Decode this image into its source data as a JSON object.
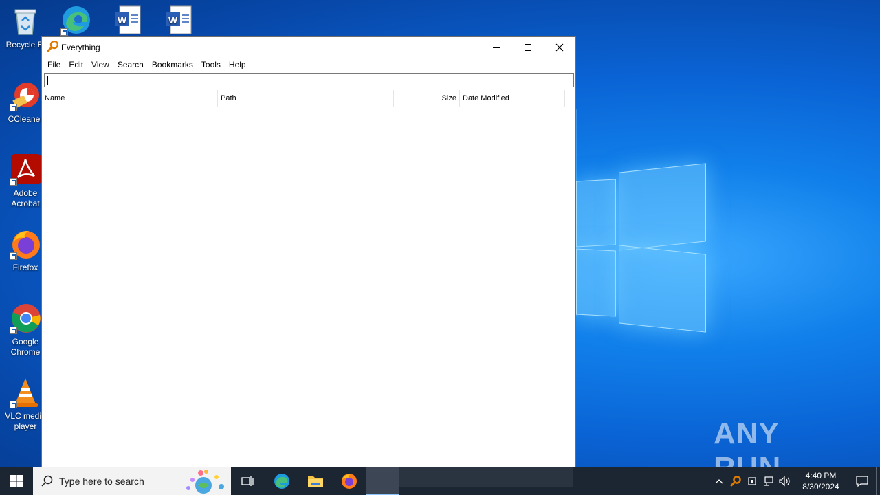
{
  "desktop": {
    "icons": [
      {
        "label": "Recycle Bi"
      },
      {
        "label": ""
      },
      {
        "label": ""
      },
      {
        "label": ""
      },
      {
        "label": "CCleaner"
      },
      {
        "label": "Adobe Acrobat"
      },
      {
        "label": "Firefox"
      },
      {
        "label": "Google Chrome"
      },
      {
        "label": "VLC media player"
      }
    ],
    "watermark": "ANY RUN"
  },
  "window": {
    "title": "Everything",
    "menu": [
      "File",
      "Edit",
      "View",
      "Search",
      "Bookmarks",
      "Tools",
      "Help"
    ],
    "search": {
      "value": "",
      "placeholder": ""
    },
    "columns": [
      "Name",
      "Path",
      "Size",
      "Date Modified"
    ]
  },
  "taskbar": {
    "search_placeholder": "Type here to search",
    "time": "4:40 PM",
    "date": "8/30/2024"
  },
  "colors": {
    "taskbar": "#1c2633",
    "accent": "#0a63d4"
  }
}
